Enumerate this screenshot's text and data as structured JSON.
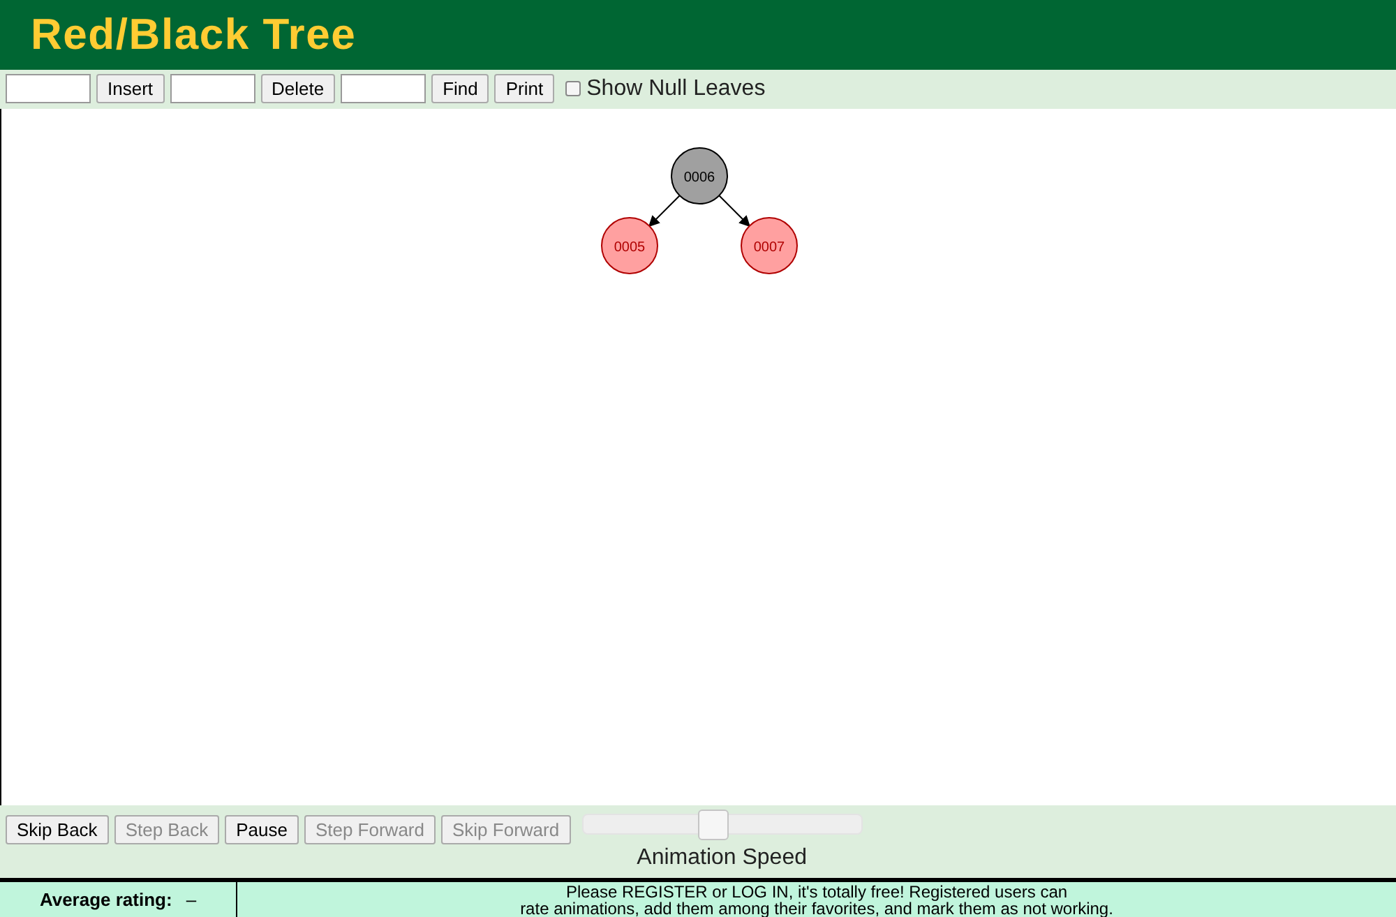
{
  "title": "Red/Black Tree",
  "toolbar": {
    "items": [
      {
        "kind": "field",
        "value": ""
      },
      {
        "kind": "button",
        "label": "Insert"
      },
      {
        "kind": "field",
        "value": ""
      },
      {
        "kind": "button",
        "label": "Delete"
      },
      {
        "kind": "field",
        "value": ""
      },
      {
        "kind": "button",
        "label": "Find"
      },
      {
        "kind": "button",
        "label": "Print"
      },
      {
        "kind": "checkbox",
        "label": "Show Null Leaves",
        "checked": false
      }
    ]
  },
  "tree": {
    "label": "0006",
    "kind": "black",
    "children": [
      {
        "label": "0005",
        "kind": "red"
      },
      {
        "label": "0007",
        "kind": "red"
      }
    ]
  },
  "controls": [
    {
      "label": "Skip Back",
      "disabled": false
    },
    {
      "label": "Step Back",
      "disabled": true
    },
    {
      "label": "Pause",
      "disabled": false
    },
    {
      "label": "Step Forward",
      "disabled": true
    },
    {
      "label": "Skip Forward",
      "disabled": true
    }
  ],
  "speed": {
    "label": "Animation Speed",
    "level": 0.47
  },
  "footer": {
    "rating_label": "Average rating:",
    "rating_value": "–",
    "message_lines": [
      "Please REGISTER or LOG IN, it's totally free! Registered users can",
      "rate animations, add them among their favorites, and mark them as not working."
    ]
  }
}
